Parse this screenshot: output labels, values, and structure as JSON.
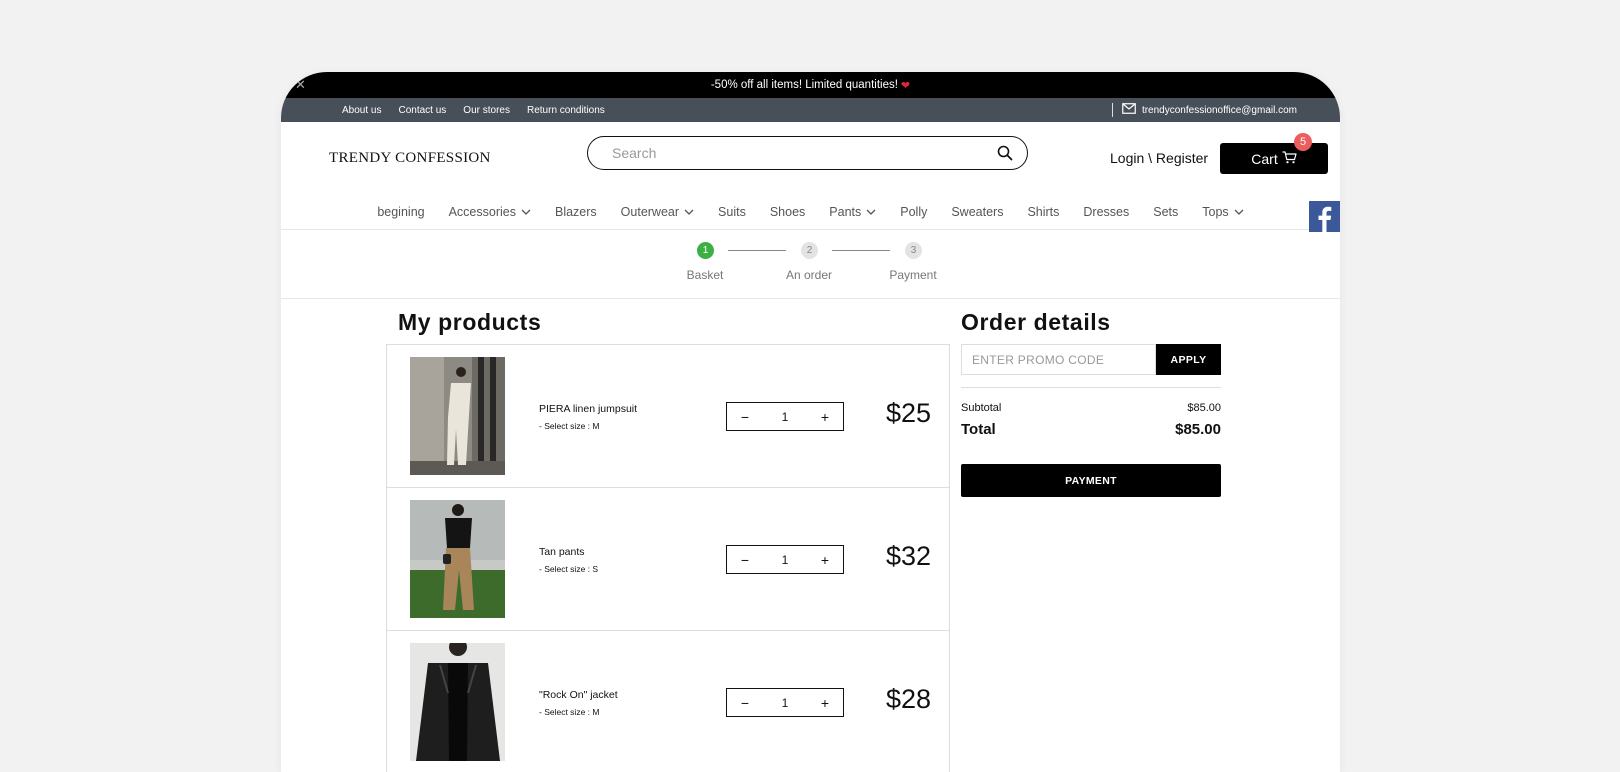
{
  "announcement": {
    "text": "-50% off all items! Limited quantities!",
    "heart": "❤",
    "close_icon": "close-icon"
  },
  "top_links": [
    "About us",
    "Contact us",
    "Our stores",
    "Return conditions"
  ],
  "contact": {
    "email": "trendyconfessionoffice@gmail.com",
    "icon": "mail-icon"
  },
  "brand": {
    "name": "TRENDY CONFESSION"
  },
  "search": {
    "placeholder": "Search",
    "value": "",
    "icon": "search-icon"
  },
  "account": {
    "login_label": "Login \\ Register"
  },
  "cart": {
    "label": "Cart",
    "count": "5",
    "icon": "cart-icon"
  },
  "nav": [
    {
      "label": "begining",
      "dropdown": false
    },
    {
      "label": "Accessories",
      "dropdown": true
    },
    {
      "label": "Blazers",
      "dropdown": false
    },
    {
      "label": "Outerwear",
      "dropdown": true
    },
    {
      "label": "Suits",
      "dropdown": false
    },
    {
      "label": "Shoes",
      "dropdown": false
    },
    {
      "label": "Pants",
      "dropdown": true
    },
    {
      "label": "Polly",
      "dropdown": false
    },
    {
      "label": "Sweaters",
      "dropdown": false
    },
    {
      "label": "Shirts",
      "dropdown": false
    },
    {
      "label": "Dresses",
      "dropdown": false
    },
    {
      "label": "Sets",
      "dropdown": false
    },
    {
      "label": "Tops",
      "dropdown": true
    }
  ],
  "steps": [
    {
      "num": "1",
      "label": "Basket",
      "active": true
    },
    {
      "num": "2",
      "label": "An order",
      "active": false
    },
    {
      "num": "3",
      "label": "Payment",
      "active": false
    }
  ],
  "products_title": "My products",
  "products": [
    {
      "name": "PIERA linen jumpsuit",
      "size": "- Select size : M",
      "qty": "1",
      "price": "$25"
    },
    {
      "name": "Tan pants",
      "size": "- Select size : S",
      "qty": "1",
      "price": "$32"
    },
    {
      "name": "\"Rock On\" jacket",
      "size": "- Select size : M",
      "qty": "1",
      "price": "$28"
    }
  ],
  "order": {
    "title": "Order details",
    "promo_placeholder": "ENTER PROMO CODE",
    "apply_label": "APPLY",
    "subtotal_label": "Subtotal",
    "subtotal_value": "$85.00",
    "total_label": "Total",
    "total_value": "$85.00",
    "payment_label": "PAYMENT"
  },
  "colors": {
    "accent_green": "#3cb045",
    "cart_badge": "#ec5e5e",
    "info_bar": "#475059",
    "facebook": "#3b5998"
  }
}
